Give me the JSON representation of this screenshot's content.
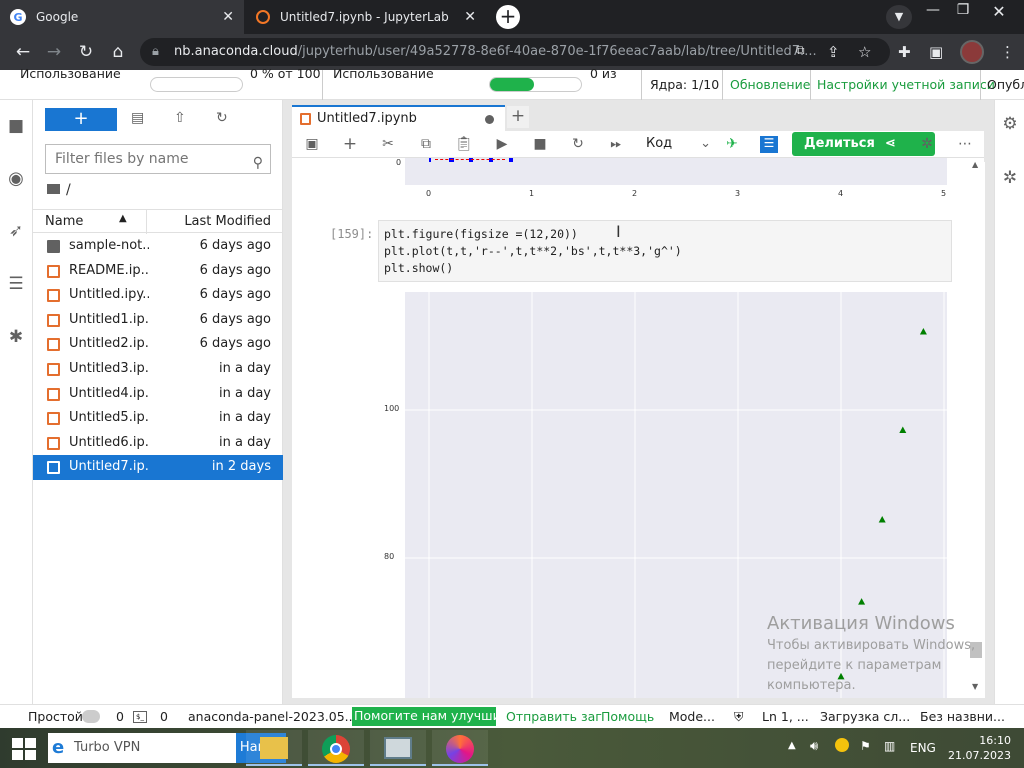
{
  "browser": {
    "tabs": [
      {
        "title": "Google",
        "icon": "google-icon"
      },
      {
        "title": "Untitled7.ipynb - JupyterLab",
        "icon": "jupyter-icon"
      }
    ],
    "url_host": "nb.anaconda.cloud",
    "url_path": "/jupyterhub/user/49a52778-8e6f-40ae-870e-1f76eeac7aab/lab/tree/Untitled7...."
  },
  "header": {
    "usage_label": "Использование",
    "usage_value": "0 % от 100",
    "usage2_label": "Использование",
    "usage2_value": "0 из",
    "cores": "Ядра: 1/10",
    "update": "Обновление",
    "account": "Настройки учетной записи",
    "publish": "Опубл"
  },
  "filebrowser": {
    "new_label": "+",
    "filter_placeholder": "Filter files by name",
    "breadcrumb": "/",
    "col_name": "Name",
    "col_modified": "Last Modified",
    "files": [
      {
        "name": "sample-not...",
        "modified": "6 days ago",
        "type": "folder"
      },
      {
        "name": "README.ip...",
        "modified": "6 days ago",
        "type": "notebook"
      },
      {
        "name": "Untitled.ipy...",
        "modified": "6 days ago",
        "type": "notebook"
      },
      {
        "name": "Untitled1.ip...",
        "modified": "6 days ago",
        "type": "notebook"
      },
      {
        "name": "Untitled2.ip...",
        "modified": "6 days ago",
        "type": "notebook"
      },
      {
        "name": "Untitled3.ip...",
        "modified": "in a day",
        "type": "notebook"
      },
      {
        "name": "Untitled4.ip...",
        "modified": "in a day",
        "type": "notebook"
      },
      {
        "name": "Untitled5.ip...",
        "modified": "in a day",
        "type": "notebook"
      },
      {
        "name": "Untitled6.ip...",
        "modified": "in a day",
        "type": "notebook"
      },
      {
        "name": "Untitled7.ip...",
        "modified": "in 2 days",
        "type": "notebook",
        "selected": true
      }
    ]
  },
  "notebook": {
    "tab_title": "Untitled7.ipynb",
    "kernel_mode": "Код",
    "share_label": "Делиться",
    "prompt": "[159]:",
    "code": [
      "plt.figure(figsize =(12,20))",
      "plt.plot(t,t,'r--',t,t**2,'bs',t,t**3,'g^')",
      "plt.show()"
    ],
    "plot1_xticks": [
      "0",
      "1",
      "2",
      "3",
      "4",
      "5"
    ],
    "plot1_ytick": "0",
    "plot2_yticks": [
      "100",
      "80"
    ]
  },
  "chart_data": {
    "type": "scatter",
    "title": "",
    "xlabel": "",
    "ylabel": "",
    "series": [
      {
        "marker": "g^",
        "color": "#008000",
        "x": [
          4.0,
          4.2,
          4.4,
          4.6,
          4.8
        ],
        "y": [
          64.0,
          74.1,
          85.2,
          97.3,
          110.6
        ]
      }
    ],
    "yticks": [
      80,
      100
    ],
    "grid": true
  },
  "watermark": {
    "title": "Активация Windows",
    "line1": "Чтобы активировать Windows,",
    "line2": "перейдите к параметрам",
    "line3": "компьютера."
  },
  "status": {
    "mode": "Простой",
    "n1": "0",
    "n2": "0",
    "panel": "anaconda-panel-2023.05...",
    "help": "Помогите нам улучшить",
    "send": "Отправить заг",
    "helplink": "Помощь",
    "mode2": "Mode...",
    "ln": "Ln 1, ...",
    "loading": "Загрузка сл...",
    "untitled": "Без назвни..."
  },
  "taskbar": {
    "search_text": "Turbo VPN",
    "find_label": "Найти",
    "lang": "ENG",
    "time": "16:10",
    "date": "21.07.2023"
  },
  "colors": {
    "accent": "#1976d2",
    "share_green": "#1fb24b",
    "chrome_dark": "#202124"
  }
}
